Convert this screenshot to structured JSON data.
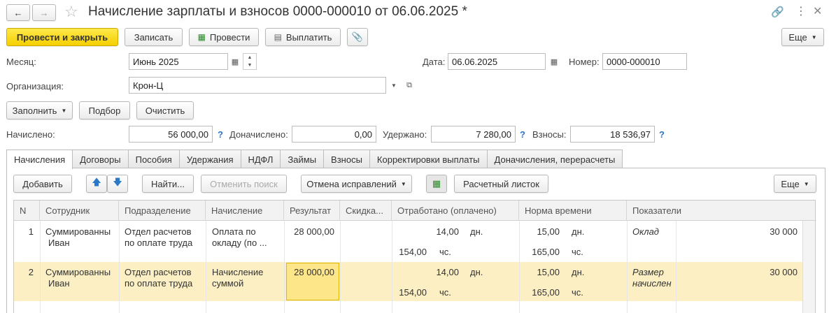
{
  "window": {
    "title": "Начисление зарплаты и взносов 0000-000010 от 06.06.2025 *",
    "link_icon": "link-icon",
    "menu_icon": "kebab-menu-icon",
    "close_icon": "close-icon"
  },
  "toolbar": {
    "post_close": "Провести и закрыть",
    "save": "Записать",
    "post": "Провести",
    "pay": "Выплатить",
    "more": "Еще"
  },
  "form": {
    "month_label": "Месяц:",
    "month_value": "Июнь 2025",
    "date_label": "Дата:",
    "date_value": "06.06.2025",
    "number_label": "Номер:",
    "number_value": "0000-000010",
    "org_label": "Организация:",
    "org_value": "Крон-Ц",
    "fill": "Заполнить",
    "select": "Подбор",
    "clear": "Очистить",
    "accrued_label": "Начислено:",
    "accrued_value": "56 000,00",
    "additional_label": "Доначислено:",
    "additional_value": "0,00",
    "withheld_label": "Удержано:",
    "withheld_value": "7 280,00",
    "contrib_label": "Взносы:",
    "contrib_value": "18 536,97",
    "q": "?"
  },
  "tabs": [
    "Начисления",
    "Договоры",
    "Пособия",
    "Удержания",
    "НДФЛ",
    "Займы",
    "Взносы",
    "Корректировки выплаты",
    "Доначисления, перерасчеты"
  ],
  "table_toolbar": {
    "add": "Добавить",
    "find": "Найти...",
    "cancel_search": "Отменить поиск",
    "cancel_fixes": "Отмена исправлений",
    "payslip": "Расчетный листок",
    "more": "Еще"
  },
  "table": {
    "columns": [
      "N",
      "Сотрудник",
      "Подразделение",
      "Начисление",
      "Результат",
      "Скидка...",
      "Отработано (оплачено)",
      "Норма времени",
      "Показатели"
    ],
    "rows": [
      {
        "n": "1",
        "employee_1": "Суммированны",
        "employee_2": "Иван",
        "dept_1": "Отдел расчетов",
        "dept_2": "по оплате труда",
        "accrual_1": "Оплата по",
        "accrual_2": "окладу (по ...",
        "result": "28 000,00",
        "worked_days": "14,00",
        "days_unit": "дн.",
        "worked_hours": "154,00",
        "hours_unit": "чс.",
        "norm_days": "15,00",
        "norm_days_unit": "дн.",
        "norm_hours": "165,00",
        "norm_hours_unit": "чс.",
        "indicator_1": "Оклад",
        "indicator_2": "",
        "indicator_value": "30 000"
      },
      {
        "n": "2",
        "employee_1": "Суммированны",
        "employee_2": "Иван",
        "dept_1": "Отдел расчетов",
        "dept_2": "по оплате труда",
        "accrual_1": "Начисление",
        "accrual_2": "суммой",
        "result": "28 000,00",
        "worked_days": "14,00",
        "days_unit": "дн.",
        "worked_hours": "154,00",
        "hours_unit": "чс.",
        "norm_days": "15,00",
        "norm_days_unit": "дн.",
        "norm_hours": "165,00",
        "norm_hours_unit": "чс.",
        "indicator_1": "Размер",
        "indicator_2": "начислен",
        "indicator_value": "30 000"
      }
    ]
  }
}
